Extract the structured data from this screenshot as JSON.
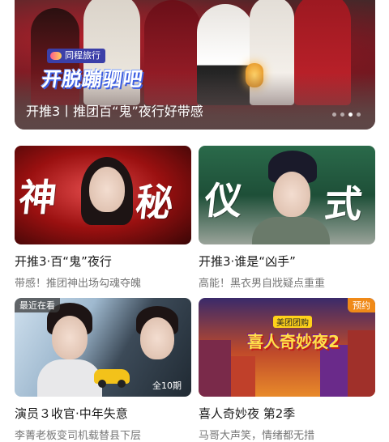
{
  "hero": {
    "brand_label": "同程旅行",
    "title_art": "开脱蹦驷吧",
    "caption": "开推3丨推团百“鬼”夜行好带感",
    "dots": [
      false,
      false,
      true,
      false
    ]
  },
  "cards": [
    {
      "thumb_chars": [
        "神",
        "秘"
      ],
      "title": "开推3·百“鬼”夜行",
      "subtitle": "带感！推团神出场勾魂夺魄"
    },
    {
      "thumb_chars": [
        "仪",
        "式"
      ],
      "title": "开推3·谁是“凶手”",
      "subtitle": "高能！黑衣男自戕疑点重重"
    },
    {
      "badge_recent": "最近在看",
      "badge_episodes": "全10期",
      "title": "演员３收官·中年失意",
      "subtitle": "李菁老板变司机载替县下层"
    },
    {
      "badge_reserve": "预约",
      "logo_tag": "美团团购",
      "logo_text": "喜人奇妙夜2",
      "title": "喜人奇妙夜 第2季",
      "subtitle": "马哥大声笑，情绪都无措"
    }
  ],
  "colors": {
    "accent_orange": "#f08a18",
    "brand_blue": "#3b3fa8"
  }
}
